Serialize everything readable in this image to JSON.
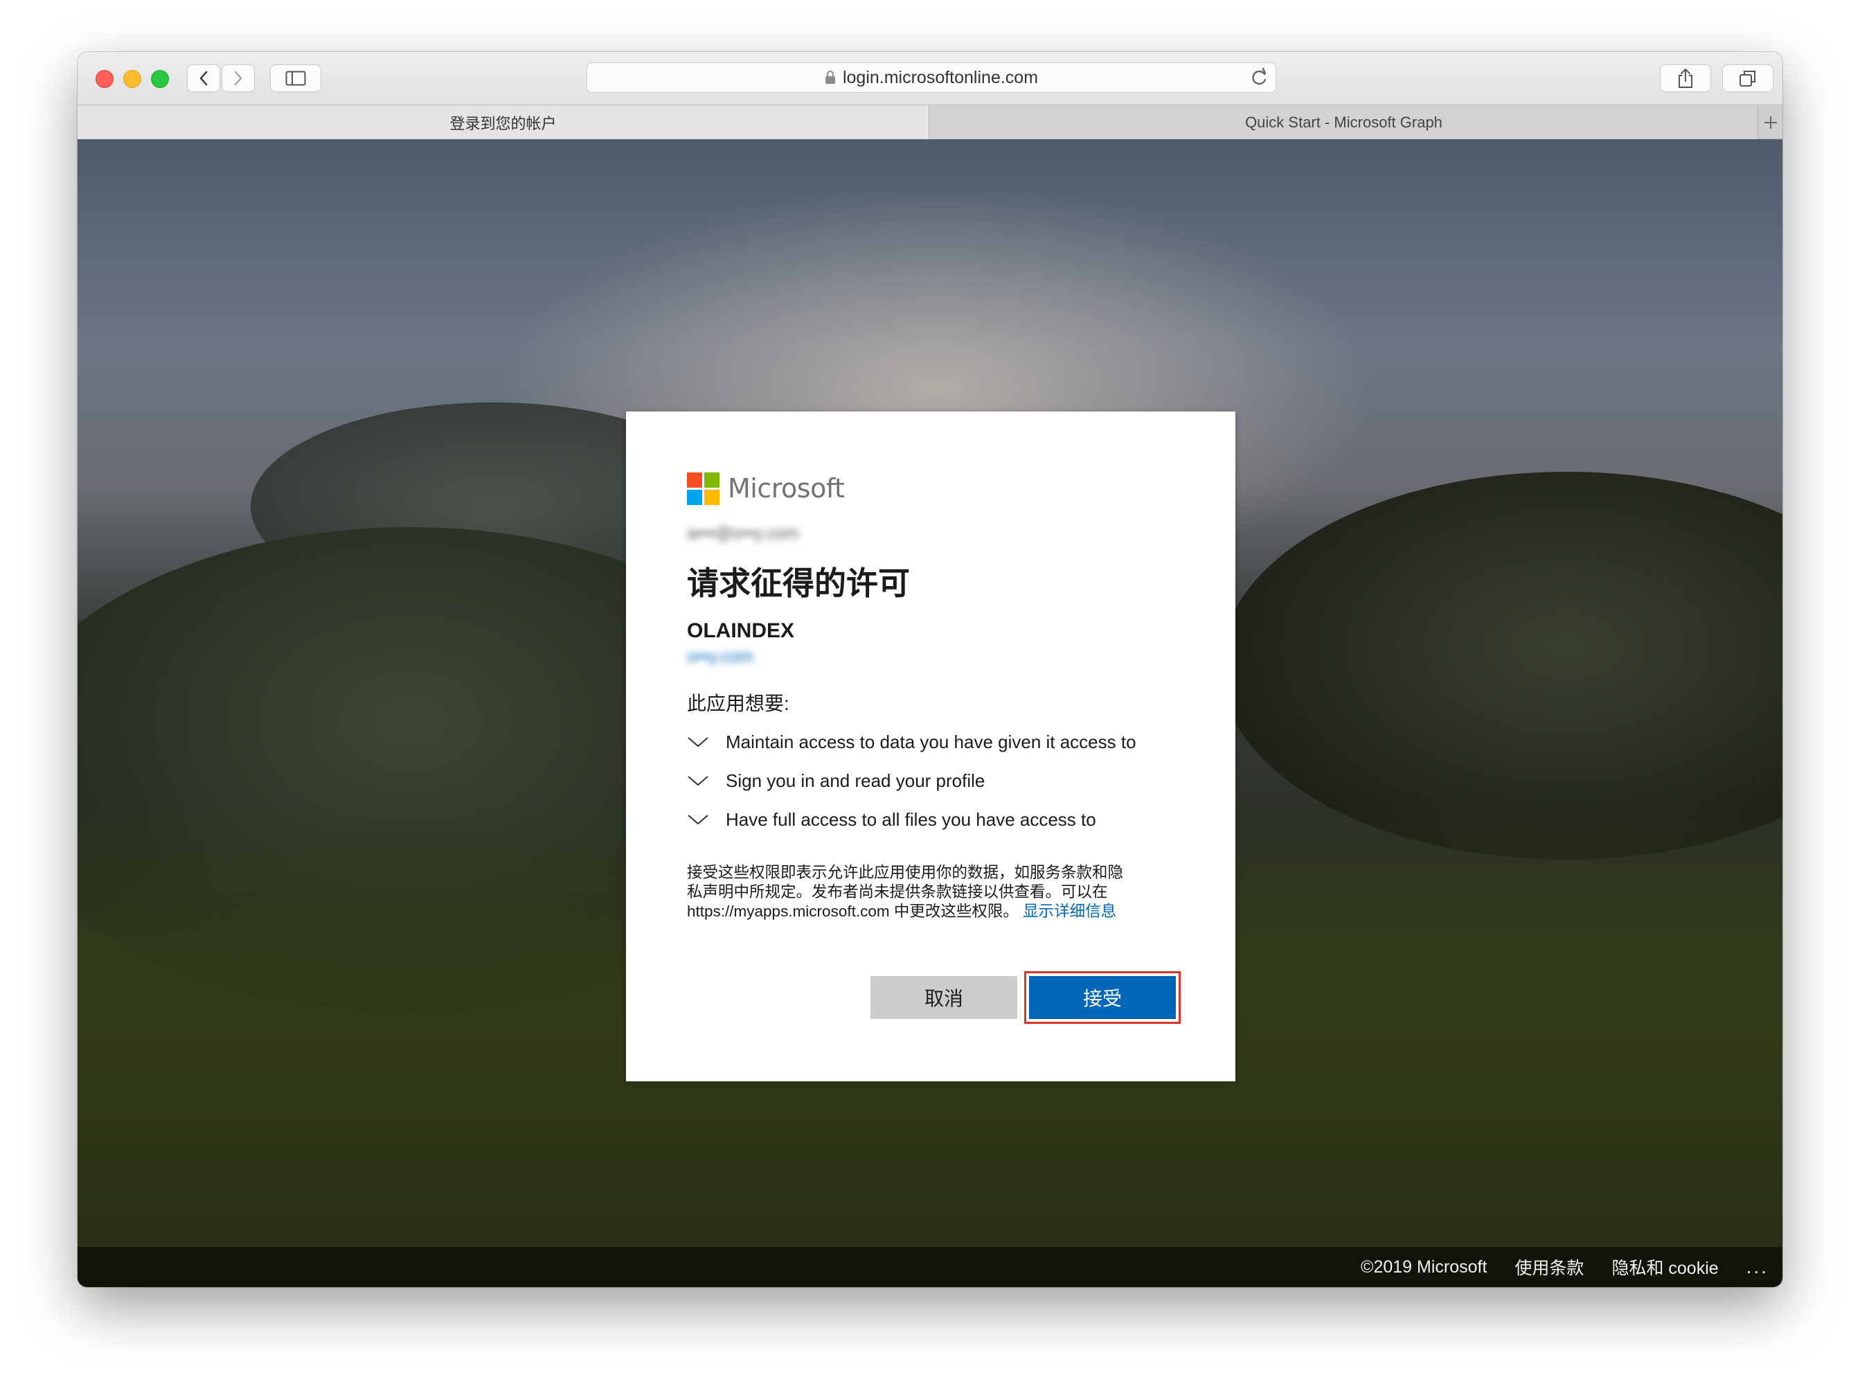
{
  "browser": {
    "url": "login.microsoftonline.com",
    "tabs": [
      {
        "label": "登录到您的帐户",
        "active": true
      },
      {
        "label": "Quick Start - Microsoft Graph",
        "active": false
      }
    ]
  },
  "dialog": {
    "brand": "Microsoft",
    "account": "a•••@o••y.com",
    "title": "请求征得的许可",
    "app_name": "OLAINDEX",
    "app_domain": "o••y.com",
    "wants_label": "此应用想要:",
    "permissions": [
      "Maintain access to data you have given it access to",
      "Sign you in and read your profile",
      "Have full access to all files you have access to"
    ],
    "notice_line1": "接受这些权限即表示允许此应用使用你的数据，如服务条款和隐",
    "notice_line2": "私声明中所规定。发布者尚未提供条款链接以供查看。可以在",
    "notice_line3": "https://myapps.microsoft.com 中更改这些权限。",
    "details_link": "显示详细信息",
    "cancel_label": "取消",
    "accept_label": "接受"
  },
  "footer": {
    "copyright": "©2019 Microsoft",
    "terms": "使用条款",
    "privacy": "隐私和 cookie",
    "more": "..."
  },
  "colors": {
    "accent": "#0067b8",
    "highlight": "#d9342b",
    "ms_red": "#f25022",
    "ms_green": "#7fba00",
    "ms_blue": "#00a4ef",
    "ms_yellow": "#ffb900"
  }
}
